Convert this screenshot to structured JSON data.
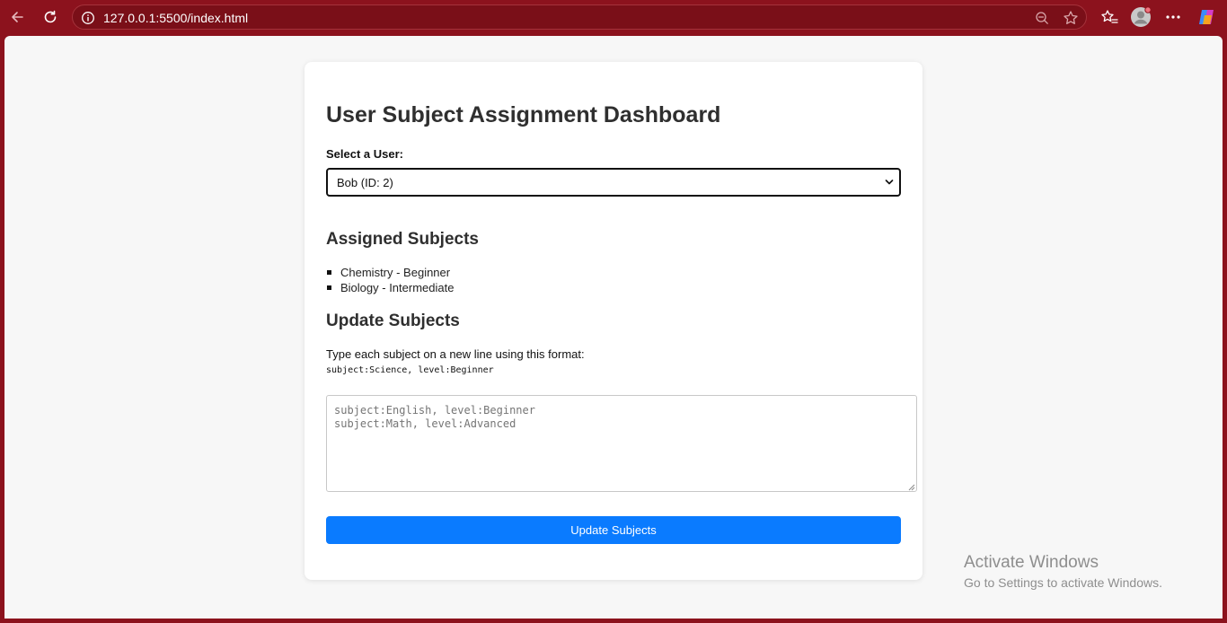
{
  "browser": {
    "url": "127.0.0.1:5500/index.html",
    "icons": [
      "back-icon",
      "refresh-icon",
      "info-icon",
      "zoom-out-icon",
      "favorite-star-icon",
      "favorites-list-icon",
      "profile-avatar",
      "more-icon",
      "copilot-icon"
    ],
    "accent_color": "#8c121d"
  },
  "page": {
    "title": "User Subject Assignment Dashboard",
    "select_label": "Select a User:",
    "selected_user": "Bob (ID: 2)",
    "assigned_heading": "Assigned Subjects",
    "assigned_subjects": [
      "Chemistry - Beginner",
      "Biology - Intermediate"
    ],
    "update_heading": "Update Subjects",
    "instructions": "Type each subject on a new line using this format:",
    "format_example": "subject:Science, level:Beginner",
    "textarea_placeholder": "subject:English, level:Beginner\nsubject:Math, level:Advanced",
    "update_button_label": "Update Subjects",
    "button_color": "#0a7bff"
  },
  "watermark": {
    "line1": "Activate Windows",
    "line2": "Go to Settings to activate Windows."
  }
}
